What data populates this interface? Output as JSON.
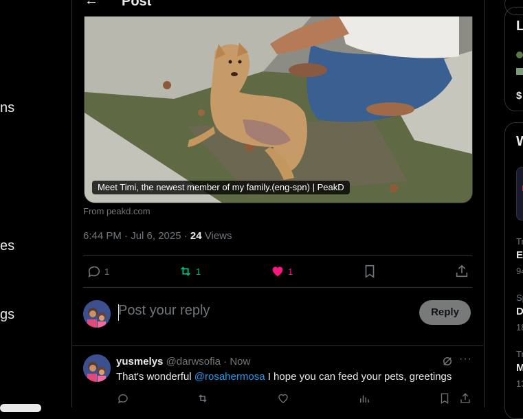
{
  "header": {
    "title": "Post"
  },
  "left_nav": {
    "items": [
      "ns",
      "es",
      "gs"
    ]
  },
  "media": {
    "caption": "Meet Timi, the newest member of my family.(eng-spn) | PeakD",
    "source": "From peakd.com"
  },
  "post_meta": {
    "time": "6:44 PM · Jul 6, 2025 · ",
    "views_count": "24",
    "views_label": " Views"
  },
  "actions": {
    "replies": "1",
    "reposts": "1",
    "likes": "1",
    "colors": {
      "repost": "#00ba7c",
      "like": "#f91880",
      "muted": "#71767b"
    }
  },
  "composer": {
    "placeholder": "Post your reply",
    "button": "Reply"
  },
  "reply": {
    "name": "yusmelys",
    "handle": "@darwsofia · Now",
    "text_before": "That's wonderful ",
    "mention": "@rosahermosa",
    "text_after": " I hope you can feed your pets, greetings"
  },
  "right_column": {
    "card1": {
      "heading": "L",
      "price": "$"
    },
    "card2": {
      "heading": "W",
      "trends": [
        {
          "label": "Tr",
          "title": "E",
          "count": "94"
        },
        {
          "label": "Sp",
          "title": "D",
          "count": "18"
        },
        {
          "label": "Tr",
          "title": "M",
          "count": "13"
        }
      ]
    }
  }
}
